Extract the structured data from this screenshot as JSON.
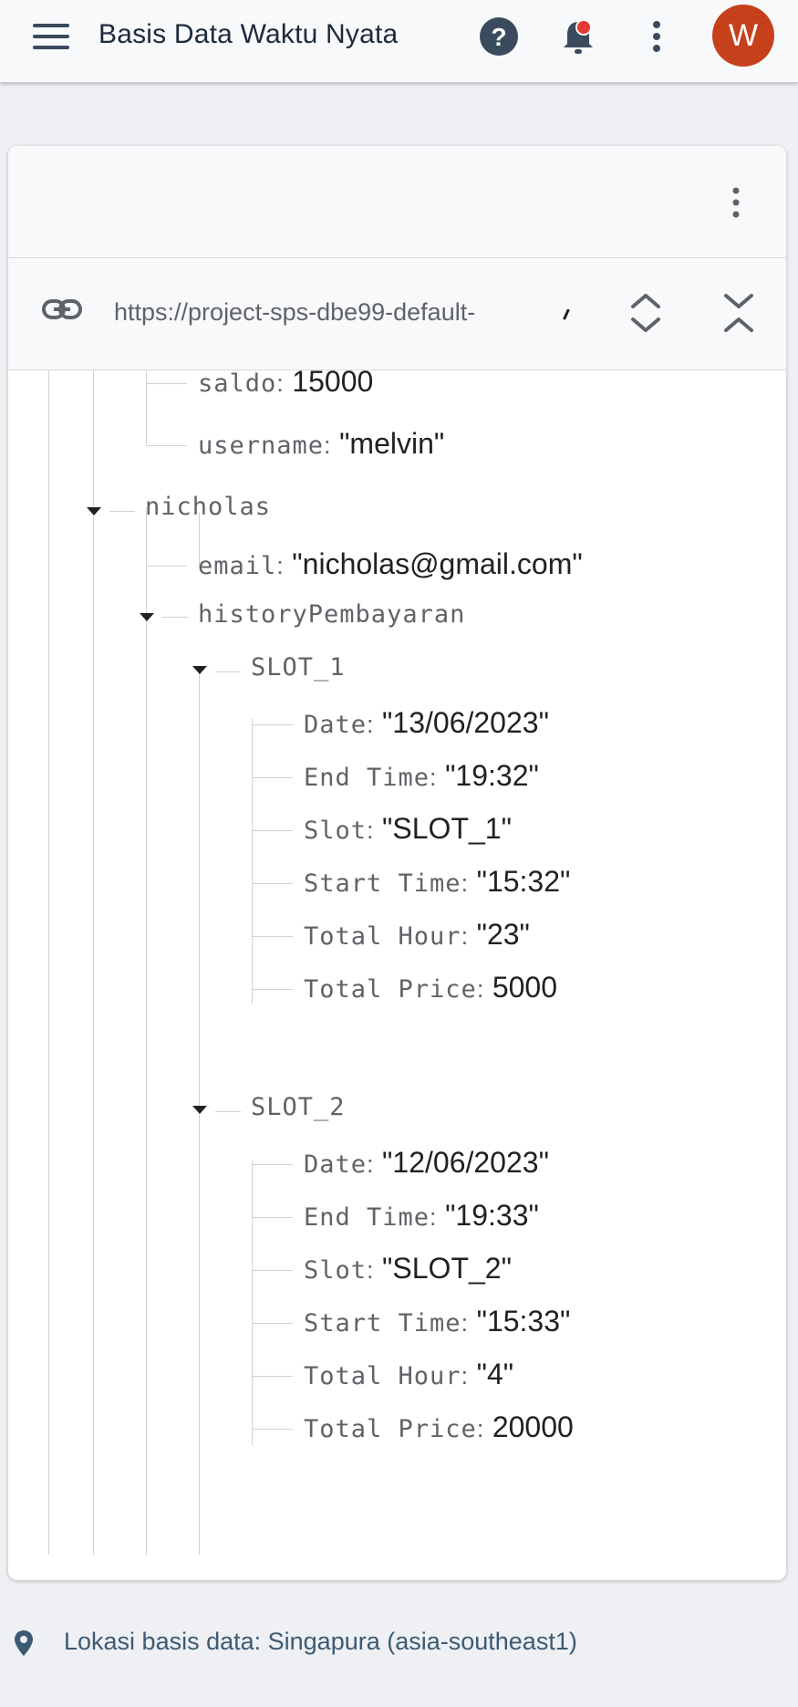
{
  "appbar": {
    "title": "Basis Data Waktu Nyata",
    "avatar_initial": "W",
    "icons": [
      "menu-icon",
      "help-icon",
      "notification-bell-icon",
      "more-vert-icon"
    ],
    "colors": {
      "avatar": "#c7401c",
      "notification_dot": "#e53935"
    }
  },
  "urlbar": {
    "url": "https://project-sps-dbe99-default-"
  },
  "tree": {
    "melvin_saldo": {
      "key": "saldo",
      "value": "15000"
    },
    "melvin_username": {
      "key": "username",
      "value": "\"melvin\""
    },
    "nicholas": {
      "key": "nicholas"
    },
    "nicholas_email": {
      "key": "email",
      "value": "\"nicholas@gmail.com\""
    },
    "history": {
      "key": "historyPembayaran"
    },
    "slot1": {
      "key": "SLOT_1",
      "date": {
        "key": "Date",
        "value": "\"13/06/2023\""
      },
      "end_time": {
        "key": "End Time",
        "value": "\"19:32\""
      },
      "slot": {
        "key": "Slot",
        "value": "\"SLOT_1\""
      },
      "start_time": {
        "key": "Start Time",
        "value": "\"15:32\""
      },
      "total_hour": {
        "key": "Total Hour",
        "value": "\"23\""
      },
      "total_price": {
        "key": "Total Price",
        "value": "5000"
      }
    },
    "slot2": {
      "key": "SLOT_2",
      "date": {
        "key": "Date",
        "value": "\"12/06/2023\""
      },
      "end_time": {
        "key": "End Time",
        "value": "\"19:33\""
      },
      "slot": {
        "key": "Slot",
        "value": "\"SLOT_2\""
      },
      "start_time": {
        "key": "Start Time",
        "value": "\"15:33\""
      },
      "total_hour": {
        "key": "Total Hour",
        "value": "\"4\""
      },
      "total_price": {
        "key": "Total Price",
        "value": "20000"
      }
    }
  },
  "footer": {
    "location": "Lokasi basis data: Singapura (asia-southeast1)"
  }
}
